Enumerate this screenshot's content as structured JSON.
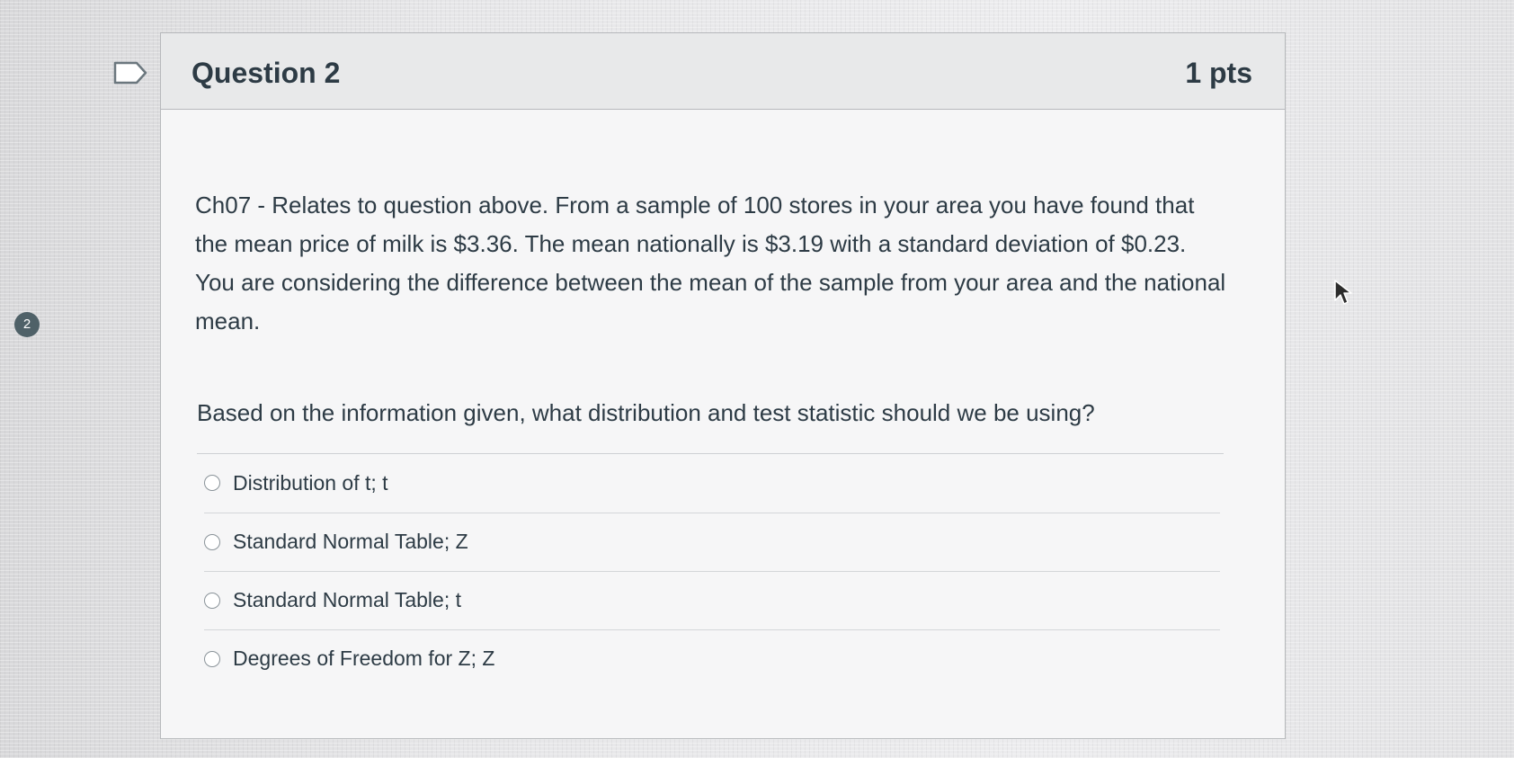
{
  "gutter": {
    "question_number": "2"
  },
  "question": {
    "title": "Question 2",
    "points": "1 pts",
    "body": "Ch07 - Relates to question above. From a sample of 100 stores in your area you have found that the mean price of milk is $3.36. The mean nationally is $3.19 with a standard deviation of $0.23. You are considering the difference between the mean of the sample from your area and the national mean.",
    "prompt": "Based on the information given, what distribution and test statistic should we be using?",
    "answers": [
      {
        "label": "Distribution of t; t",
        "selected": false
      },
      {
        "label": "Standard Normal Table; Z",
        "selected": false
      },
      {
        "label": "Standard Normal Table; t",
        "selected": false
      },
      {
        "label": "Degrees of Freedom for Z; Z",
        "selected": false
      }
    ]
  },
  "colors": {
    "text": "#2d3b45",
    "header_bg": "#e8e9ea",
    "badge_bg": "#4f6168"
  },
  "icons": {
    "flag": "flag-icon",
    "radio": "radio-icon",
    "cursor": "cursor-icon"
  }
}
